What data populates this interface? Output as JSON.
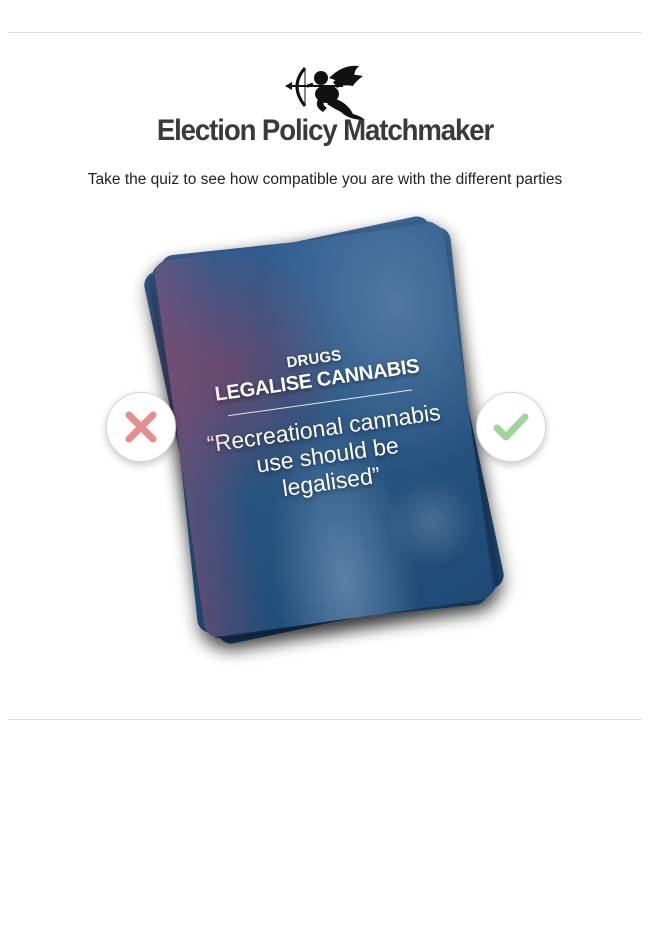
{
  "header": {
    "title": "Election Policy Matchmaker",
    "subtitle": "Take the quiz to see how compatible you are with the different parties",
    "logo_icon": "cupid-icon"
  },
  "card": {
    "category": "DRUGS",
    "heading": "LEGALISE CANNABIS",
    "statement": "“Recreational cannabis use should be legalised”",
    "background": "blurred-australian-flag"
  },
  "actions": {
    "disagree_icon": "cross-icon",
    "agree_icon": "check-icon"
  },
  "colors": {
    "disagree": "#e38f8f",
    "agree": "#9fd49a",
    "title": "#3a3a3a",
    "card_blue": "#285683"
  }
}
